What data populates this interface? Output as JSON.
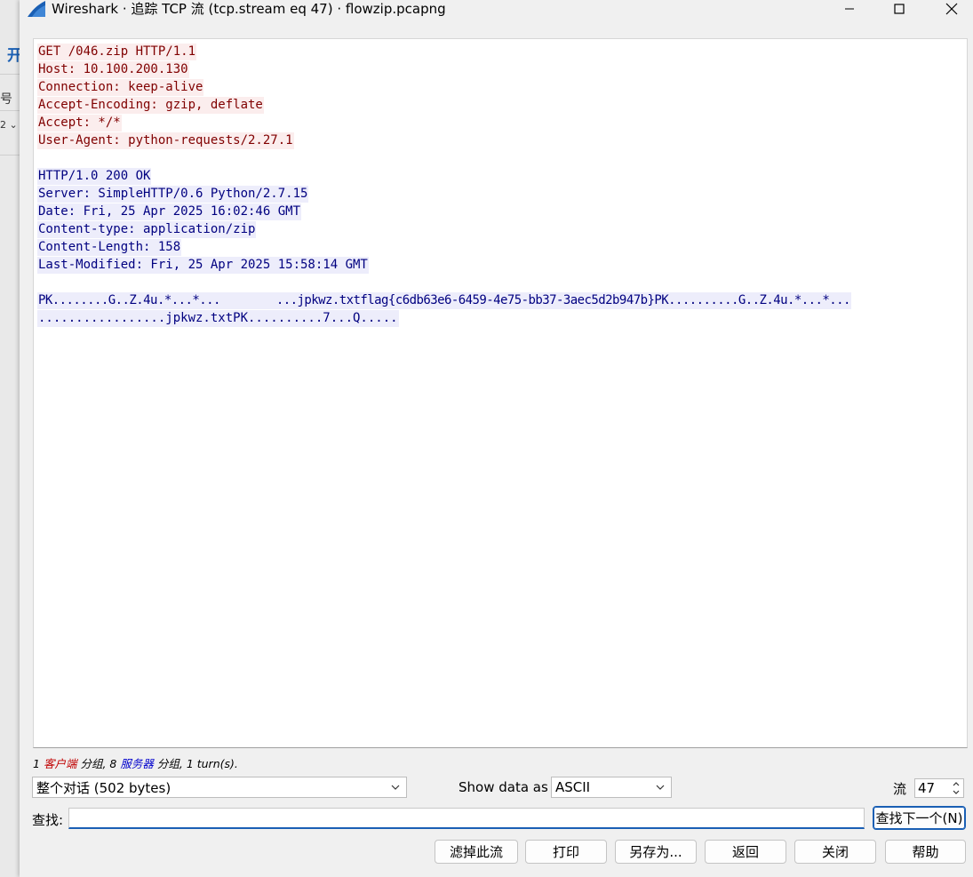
{
  "background_app": {
    "tab_char": "开",
    "row1_char": "号",
    "row2_text": "2 ⌄"
  },
  "window": {
    "title": "Wireshark · 追踪 TCP 流 (tcp.stream eq 47) · flowzip.pcapng",
    "controls": [
      "minimize-icon",
      "maximize-icon",
      "close-icon"
    ]
  },
  "stream": {
    "client_color": "#800000",
    "client_bg": "#fbeded",
    "server_color": "#000080",
    "server_bg": "#ededfb",
    "client_request": [
      "GET /046.zip HTTP/1.1",
      "Host: 10.100.200.130",
      "Connection: keep-alive",
      "Accept-Encoding: gzip, deflate",
      "Accept: */*",
      "User-Agent: python-requests/2.27.1"
    ],
    "server_headers": [
      "HTTP/1.0 200 OK",
      "Server: SimpleHTTP/0.6 Python/2.7.15",
      "Date: Fri, 25 Apr 2025 16:02:46 GMT",
      "Content-type: application/zip",
      "Content-Length: 158",
      "Last-Modified: Fri, 25 Apr 2025 15:58:14 GMT"
    ],
    "server_body": [
      "PK........G..Z.4u.*...*...        ...jpkwz.txtflag{c6db63e6-6459-4e75-bb37-3aec5d2b947b}PK..........G..Z.4u.*...*...",
      ".................jpkwz.txtPK..........7...Q....."
    ]
  },
  "summary": {
    "client_count": "1",
    "client_word": "客户端",
    "packets_word": "分组,",
    "server_count": "8",
    "server_word": "服务器",
    "packets_word2": "分组,",
    "turns": "1 turn(s)."
  },
  "controls": {
    "conversation_select": "整个对话 (502 bytes)",
    "show_data_label": "Show data as",
    "show_data_select": "ASCII",
    "stream_label": "流",
    "stream_value": "47",
    "find_label": "查找:",
    "find_value": "",
    "find_next_button": "查找下一个(N)"
  },
  "buttons": {
    "filter_out": "滤掉此流",
    "print": "打印",
    "save_as": "另存为...",
    "back": "返回",
    "close": "关闭",
    "help": "帮助"
  }
}
